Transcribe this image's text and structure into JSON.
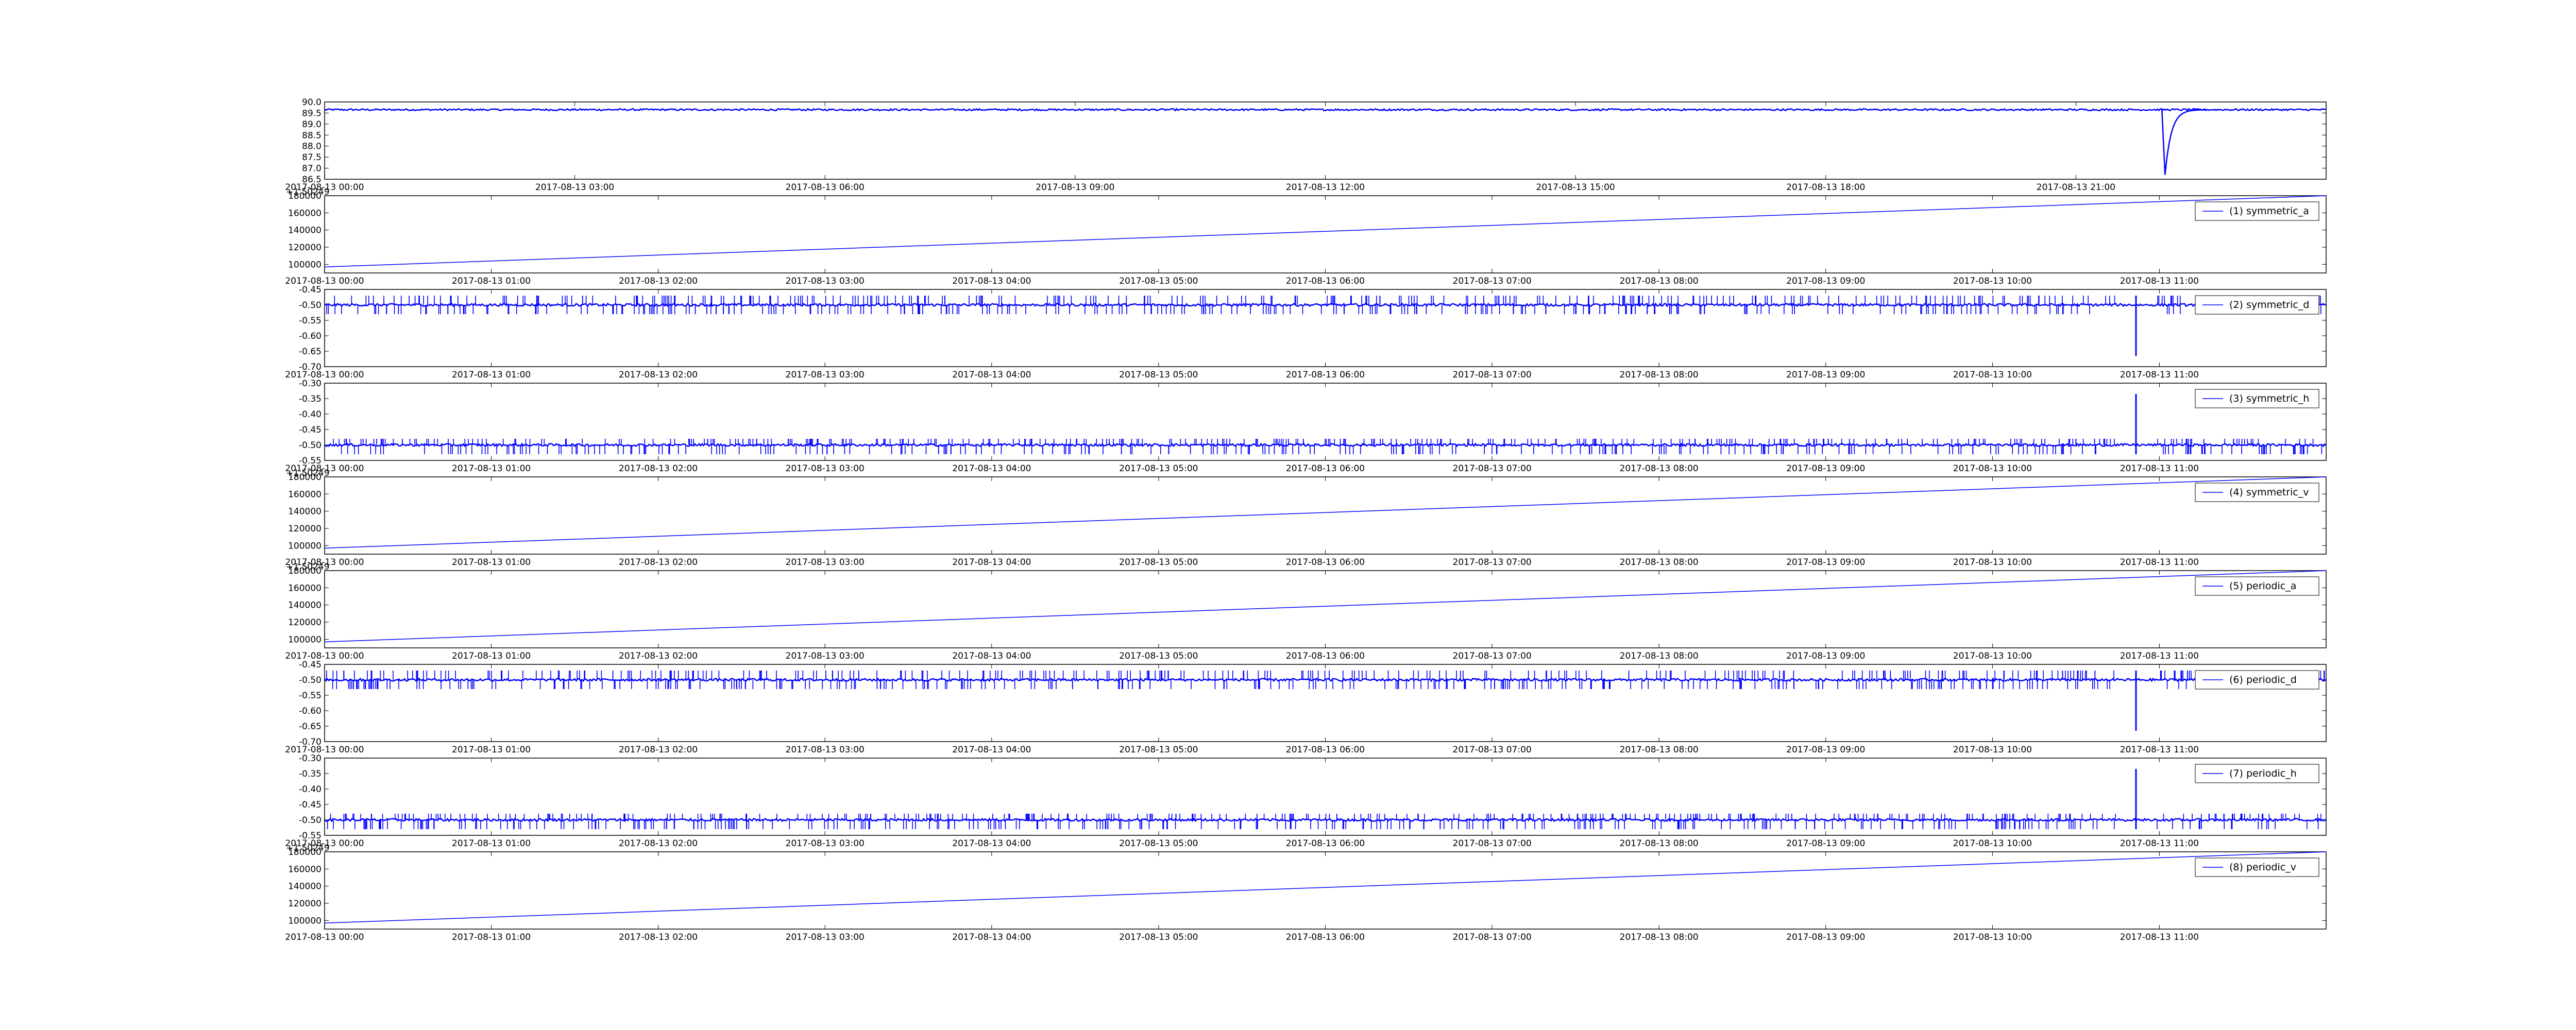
{
  "line_color": "#0000ff",
  "chart_data": [
    {
      "type": "line",
      "title": "",
      "xlabel": "",
      "ylabel": "",
      "grid": false,
      "legend": "",
      "ylim": [
        86.5,
        90.0
      ],
      "yticks": [
        "90.0",
        "89.5",
        "89.0",
        "88.5",
        "88.0",
        "87.5",
        "87.0",
        "86.5"
      ],
      "yvals": [
        90.0,
        89.5,
        89.0,
        88.5,
        88.0,
        87.5,
        87.0,
        86.5
      ],
      "offset_text": "",
      "xticks": [
        "2017-08-13 00:00",
        "2017-08-13 03:00",
        "2017-08-13 06:00",
        "2017-08-13 09:00",
        "2017-08-13 12:00",
        "2017-08-13 15:00",
        "2017-08-13 18:00",
        "2017-08-13 21:00"
      ],
      "xtick_frac": [
        0,
        0.125,
        0.25,
        0.375,
        0.5,
        0.625,
        0.75,
        0.875
      ],
      "series": [
        {
          "kind": "spike",
          "baseline": 89.65,
          "noise": 0.04,
          "spikes": [],
          "dip_frac": 0.9195,
          "dip_min": 86.7
        }
      ]
    },
    {
      "type": "line",
      "title": "",
      "xlabel": "",
      "ylabel": "",
      "grid": false,
      "legend": "top-right",
      "ylim": [
        90000,
        180000
      ],
      "yticks": [
        "180000",
        "160000",
        "140000",
        "120000",
        "100000"
      ],
      "yvals": [
        180000,
        160000,
        140000,
        120000,
        100000
      ],
      "offset_text": "+1.50249",
      "xticks": [
        "2017-08-13 00:00",
        "2017-08-13 01:00",
        "2017-08-13 02:00",
        "2017-08-13 03:00",
        "2017-08-13 04:00",
        "2017-08-13 05:00",
        "2017-08-13 06:00",
        "2017-08-13 07:00",
        "2017-08-13 08:00",
        "2017-08-13 09:00",
        "2017-08-13 10:00",
        "2017-08-13 11:00"
      ],
      "xtick_frac": [
        0,
        0.0833,
        0.1667,
        0.25,
        0.3333,
        0.4167,
        0.5,
        0.5833,
        0.6667,
        0.75,
        0.8333,
        0.9167
      ],
      "series": [
        {
          "name": "(1) symmetric_a",
          "kind": "linear",
          "start": 97000,
          "end": 180000
        }
      ]
    },
    {
      "type": "line",
      "title": "",
      "xlabel": "",
      "ylabel": "",
      "grid": false,
      "legend": "top-right",
      "ylim": [
        -0.7,
        -0.45
      ],
      "yticks": [
        "-0.45",
        "-0.50",
        "-0.55",
        "-0.60",
        "-0.65",
        "-0.70"
      ],
      "yvals": [
        -0.45,
        -0.5,
        -0.55,
        -0.6,
        -0.65,
        -0.7
      ],
      "offset_text": "",
      "xticks": [
        "2017-08-13 00:00",
        "2017-08-13 01:00",
        "2017-08-13 02:00",
        "2017-08-13 03:00",
        "2017-08-13 04:00",
        "2017-08-13 05:00",
        "2017-08-13 06:00",
        "2017-08-13 07:00",
        "2017-08-13 08:00",
        "2017-08-13 09:00",
        "2017-08-13 10:00",
        "2017-08-13 11:00"
      ],
      "xtick_frac": [
        0,
        0.0833,
        0.1667,
        0.25,
        0.3333,
        0.4167,
        0.5,
        0.5833,
        0.6667,
        0.75,
        0.8333,
        0.9167
      ],
      "series": [
        {
          "name": "(2) symmetric_d",
          "kind": "spike",
          "baseline": -0.5,
          "noise": 0.004,
          "spikes": [
            -0.47,
            -0.53
          ],
          "dip_frac": 0.905,
          "dip_min": -0.665,
          "dip_max": -0.47
        }
      ]
    },
    {
      "type": "line",
      "title": "",
      "xlabel": "",
      "ylabel": "",
      "grid": false,
      "legend": "top-right",
      "ylim": [
        -0.55,
        -0.3
      ],
      "yticks": [
        "-0.30",
        "-0.35",
        "-0.40",
        "-0.45",
        "-0.50",
        "-0.55"
      ],
      "yvals": [
        -0.3,
        -0.35,
        -0.4,
        -0.45,
        -0.5,
        -0.55
      ],
      "offset_text": "",
      "xticks": [
        "2017-08-13 00:00",
        "2017-08-13 01:00",
        "2017-08-13 02:00",
        "2017-08-13 03:00",
        "2017-08-13 04:00",
        "2017-08-13 05:00",
        "2017-08-13 06:00",
        "2017-08-13 07:00",
        "2017-08-13 08:00",
        "2017-08-13 09:00",
        "2017-08-13 10:00",
        "2017-08-13 11:00"
      ],
      "xtick_frac": [
        0,
        0.0833,
        0.1667,
        0.25,
        0.3333,
        0.4167,
        0.5,
        0.5833,
        0.6667,
        0.75,
        0.8333,
        0.9167
      ],
      "series": [
        {
          "name": "(3) symmetric_h",
          "kind": "spike",
          "baseline": -0.5,
          "noise": 0.004,
          "spikes": [
            -0.48,
            -0.53
          ],
          "dip_frac": 0.905,
          "dip_min": -0.53,
          "dip_max": -0.335
        }
      ]
    },
    {
      "type": "line",
      "title": "",
      "xlabel": "",
      "ylabel": "",
      "grid": false,
      "legend": "top-right",
      "ylim": [
        90000,
        180000
      ],
      "yticks": [
        "180000",
        "160000",
        "140000",
        "120000",
        "100000"
      ],
      "yvals": [
        180000,
        160000,
        140000,
        120000,
        100000
      ],
      "offset_text": "+1.50249",
      "xticks": [
        "2017-08-13 00:00",
        "2017-08-13 01:00",
        "2017-08-13 02:00",
        "2017-08-13 03:00",
        "2017-08-13 04:00",
        "2017-08-13 05:00",
        "2017-08-13 06:00",
        "2017-08-13 07:00",
        "2017-08-13 08:00",
        "2017-08-13 09:00",
        "2017-08-13 10:00",
        "2017-08-13 11:00"
      ],
      "xtick_frac": [
        0,
        0.0833,
        0.1667,
        0.25,
        0.3333,
        0.4167,
        0.5,
        0.5833,
        0.6667,
        0.75,
        0.8333,
        0.9167
      ],
      "series": [
        {
          "name": "(4) symmetric_v",
          "kind": "linear",
          "start": 97000,
          "end": 180000
        }
      ]
    },
    {
      "type": "line",
      "title": "",
      "xlabel": "",
      "ylabel": "",
      "grid": false,
      "legend": "top-right",
      "ylim": [
        90000,
        180000
      ],
      "yticks": [
        "180000",
        "160000",
        "140000",
        "120000",
        "100000"
      ],
      "yvals": [
        180000,
        160000,
        140000,
        120000,
        100000
      ],
      "offset_text": "+1.50249",
      "xticks": [
        "2017-08-13 00:00",
        "2017-08-13 01:00",
        "2017-08-13 02:00",
        "2017-08-13 03:00",
        "2017-08-13 04:00",
        "2017-08-13 05:00",
        "2017-08-13 06:00",
        "2017-08-13 07:00",
        "2017-08-13 08:00",
        "2017-08-13 09:00",
        "2017-08-13 10:00",
        "2017-08-13 11:00"
      ],
      "xtick_frac": [
        0,
        0.0833,
        0.1667,
        0.25,
        0.3333,
        0.4167,
        0.5,
        0.5833,
        0.6667,
        0.75,
        0.8333,
        0.9167
      ],
      "series": [
        {
          "name": "(5) periodic_a",
          "kind": "linear",
          "start": 97000,
          "end": 180000
        }
      ]
    },
    {
      "type": "line",
      "title": "",
      "xlabel": "",
      "ylabel": "",
      "grid": false,
      "legend": "top-right",
      "ylim": [
        -0.7,
        -0.45
      ],
      "yticks": [
        "-0.45",
        "-0.50",
        "-0.55",
        "-0.60",
        "-0.65",
        "-0.70"
      ],
      "yvals": [
        -0.45,
        -0.5,
        -0.55,
        -0.6,
        -0.65,
        -0.7
      ],
      "offset_text": "",
      "xticks": [
        "2017-08-13 00:00",
        "2017-08-13 01:00",
        "2017-08-13 02:00",
        "2017-08-13 03:00",
        "2017-08-13 04:00",
        "2017-08-13 05:00",
        "2017-08-13 06:00",
        "2017-08-13 07:00",
        "2017-08-13 08:00",
        "2017-08-13 09:00",
        "2017-08-13 10:00",
        "2017-08-13 11:00"
      ],
      "xtick_frac": [
        0,
        0.0833,
        0.1667,
        0.25,
        0.3333,
        0.4167,
        0.5,
        0.5833,
        0.6667,
        0.75,
        0.8333,
        0.9167
      ],
      "series": [
        {
          "name": "(6) periodic_d",
          "kind": "spike",
          "baseline": -0.5,
          "noise": 0.004,
          "spikes": [
            -0.47,
            -0.53
          ],
          "dip_frac": 0.905,
          "dip_min": -0.665,
          "dip_max": -0.47
        }
      ]
    },
    {
      "type": "line",
      "title": "",
      "xlabel": "",
      "ylabel": "",
      "grid": false,
      "legend": "top-right",
      "ylim": [
        -0.55,
        -0.3
      ],
      "yticks": [
        "-0.30",
        "-0.35",
        "-0.40",
        "-0.45",
        "-0.50",
        "-0.55"
      ],
      "yvals": [
        -0.3,
        -0.35,
        -0.4,
        -0.45,
        -0.5,
        -0.55
      ],
      "offset_text": "",
      "xticks": [
        "2017-08-13 00:00",
        "2017-08-13 01:00",
        "2017-08-13 02:00",
        "2017-08-13 03:00",
        "2017-08-13 04:00",
        "2017-08-13 05:00",
        "2017-08-13 06:00",
        "2017-08-13 07:00",
        "2017-08-13 08:00",
        "2017-08-13 09:00",
        "2017-08-13 10:00",
        "2017-08-13 11:00"
      ],
      "xtick_frac": [
        0,
        0.0833,
        0.1667,
        0.25,
        0.3333,
        0.4167,
        0.5,
        0.5833,
        0.6667,
        0.75,
        0.8333,
        0.9167
      ],
      "series": [
        {
          "name": "(7) periodic_h",
          "kind": "spike",
          "baseline": -0.5,
          "noise": 0.004,
          "spikes": [
            -0.48,
            -0.53
          ],
          "dip_frac": 0.905,
          "dip_min": -0.53,
          "dip_max": -0.335
        }
      ]
    },
    {
      "type": "line",
      "title": "",
      "xlabel": "",
      "ylabel": "",
      "grid": false,
      "legend": "top-right",
      "ylim": [
        90000,
        180000
      ],
      "yticks": [
        "180000",
        "160000",
        "140000",
        "120000",
        "100000"
      ],
      "yvals": [
        180000,
        160000,
        140000,
        120000,
        100000
      ],
      "offset_text": "+1.50249",
      "xticks": [
        "2017-08-13 00:00",
        "2017-08-13 01:00",
        "2017-08-13 02:00",
        "2017-08-13 03:00",
        "2017-08-13 04:00",
        "2017-08-13 05:00",
        "2017-08-13 06:00",
        "2017-08-13 07:00",
        "2017-08-13 08:00",
        "2017-08-13 09:00",
        "2017-08-13 10:00",
        "2017-08-13 11:00"
      ],
      "xtick_frac": [
        0,
        0.0833,
        0.1667,
        0.25,
        0.3333,
        0.4167,
        0.5,
        0.5833,
        0.6667,
        0.75,
        0.8333,
        0.9167
      ],
      "series": [
        {
          "name": "(8) periodic_v",
          "kind": "linear",
          "start": 97000,
          "end": 180000
        }
      ]
    }
  ]
}
